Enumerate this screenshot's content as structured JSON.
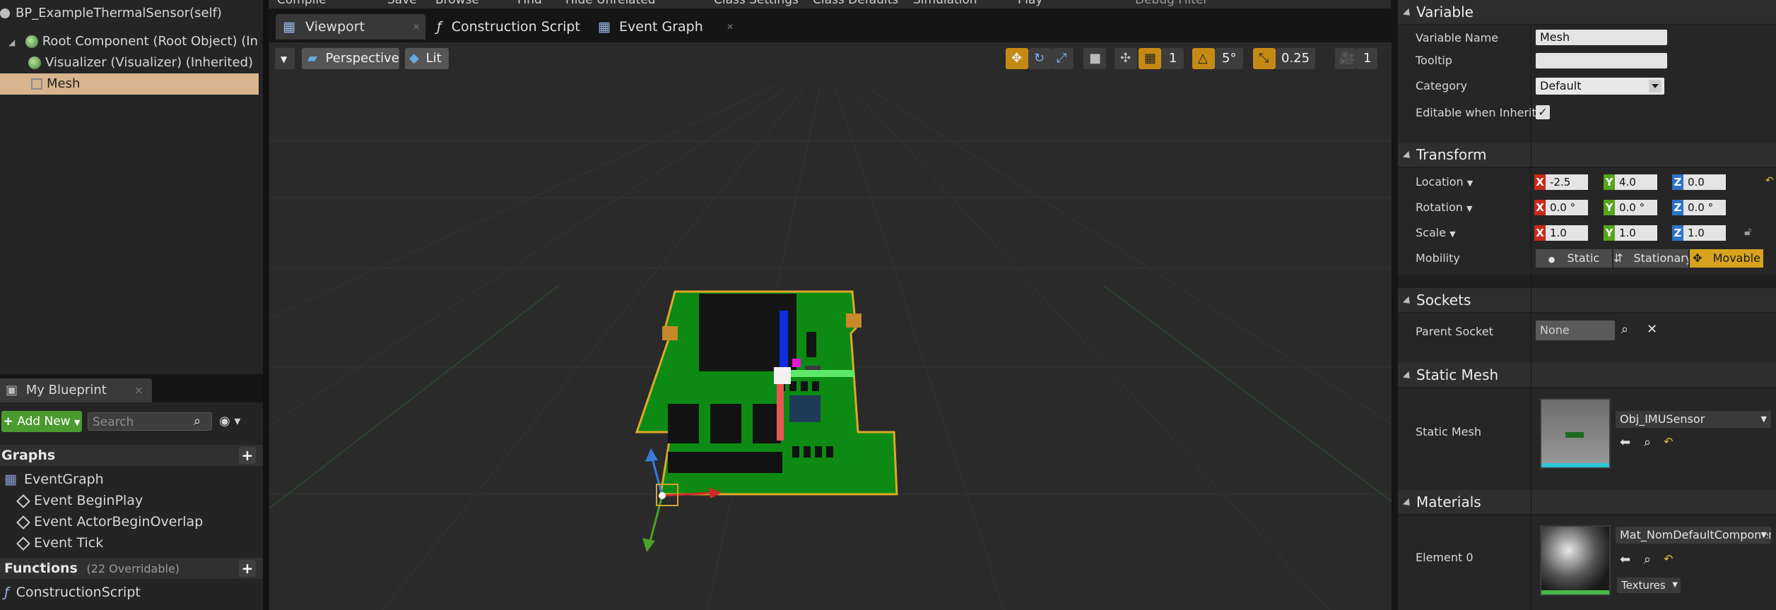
{
  "components": {
    "title": "BP_ExampleThermalSensor(self)",
    "items": [
      {
        "label": "Root Component (Root Object) (Inherited)"
      },
      {
        "label": "Visualizer (Visualizer) (Inherited)"
      },
      {
        "label": "Mesh"
      }
    ]
  },
  "my_blueprint": {
    "tab_label": "My Blueprint",
    "add_new_label": "Add New",
    "search_placeholder": "Search",
    "graphs_header": "Graphs",
    "graphs": [
      {
        "label": "EventGraph"
      },
      {
        "label": "Event BeginPlay"
      },
      {
        "label": "Event ActorBeginOverlap"
      },
      {
        "label": "Event Tick"
      }
    ],
    "functions_header": "Functions",
    "functions_note": "(22 Overridable)",
    "functions": [
      {
        "label": "ConstructionScript"
      }
    ]
  },
  "toolbar": {
    "items": [
      "Compile",
      "Save",
      "Browse",
      "Find",
      "Hide Unrelated",
      "Class Settings",
      "Class Defaults",
      "Simulation",
      "Play",
      "Debug Filter"
    ]
  },
  "tabs": [
    {
      "label": "Viewport"
    },
    {
      "label": "Construction Script"
    },
    {
      "label": "Event Graph"
    }
  ],
  "viewport": {
    "view_mode": "Perspective",
    "lighting": "Lit",
    "grid_snap": "1",
    "rotation_snap": "5°",
    "scale_snap": "0.25",
    "camera_speed": "1"
  },
  "details": {
    "variable": {
      "header": "Variable",
      "name_label": "Variable Name",
      "name_value": "Mesh",
      "tooltip_label": "Tooltip",
      "tooltip_value": "",
      "category_label": "Category",
      "category_value": "Default",
      "editable_label": "Editable when Inherited",
      "editable_checked": true
    },
    "transform": {
      "header": "Transform",
      "location_label": "Location",
      "location": {
        "x": "-2.5",
        "y": "4.0",
        "z": "0.0"
      },
      "rotation_label": "Rotation",
      "rotation": {
        "x": "0.0 °",
        "y": "0.0 °",
        "z": "0.0 °"
      },
      "scale_label": "Scale",
      "scale": {
        "x": "1.0",
        "y": "1.0",
        "z": "1.0"
      },
      "mobility_label": "Mobility",
      "mobility_options": [
        "Static",
        "Stationary",
        "Movable"
      ],
      "mobility_selected": "Movable"
    },
    "sockets": {
      "header": "Sockets",
      "parent_label": "Parent Socket",
      "parent_value": "None"
    },
    "static_mesh": {
      "header": "Static Mesh",
      "label": "Static Mesh",
      "value": "Obj_IMUSensor"
    },
    "materials": {
      "header": "Materials",
      "element_label": "Element 0",
      "value": "Mat_NomDefaultComponent",
      "textures_label": "Textures"
    }
  },
  "colors": {
    "accent_orange": "#c58a14",
    "selection": "#d8b58f",
    "add_new_green": "#4b9a2f"
  }
}
